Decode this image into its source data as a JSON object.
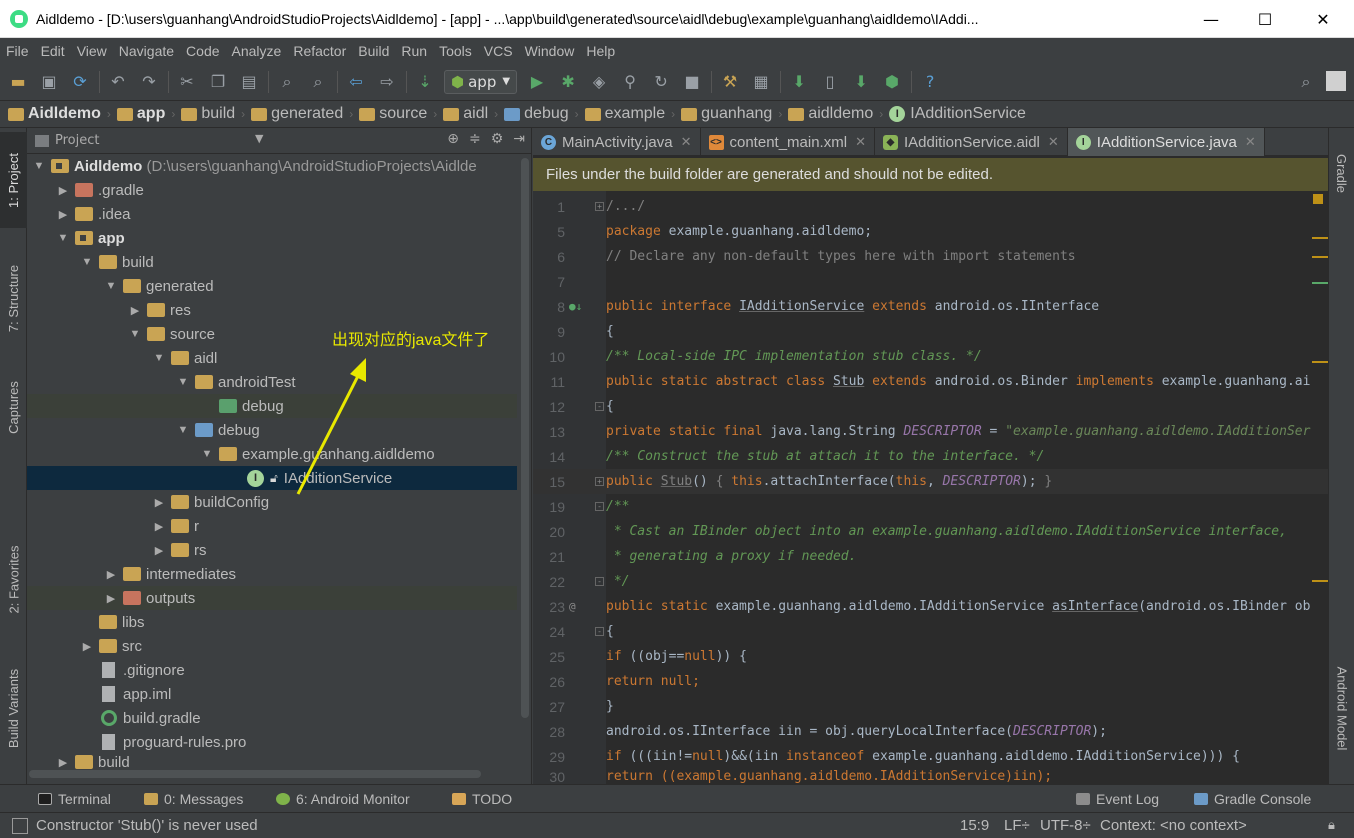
{
  "window": {
    "title": "Aidldemo - [D:\\users\\guanhang\\AndroidStudioProjects\\Aidldemo] - [app] - ...\\app\\build\\generated\\source\\aidl\\debug\\example\\guanhang\\aidldemo\\IAddi...",
    "minimize": "—",
    "maximize": "☐",
    "close": "✕"
  },
  "menu": [
    "File",
    "Edit",
    "View",
    "Navigate",
    "Code",
    "Analyze",
    "Refactor",
    "Build",
    "Run",
    "Tools",
    "VCS",
    "Window",
    "Help"
  ],
  "toolbar": {
    "run_config": "app",
    "help": "?"
  },
  "breadcrumb": [
    "Aidldemo",
    "app",
    "build",
    "generated",
    "source",
    "aidl",
    "debug",
    "example",
    "guanhang",
    "aidldemo",
    "IAdditionService"
  ],
  "left_tabs": [
    "1: Project",
    "7: Structure",
    "Captures",
    "2: Favorites",
    "Build Variants"
  ],
  "right_tabs": [
    "Gradle",
    "Android Model"
  ],
  "project_panel": {
    "view_mode": "Project",
    "tree": [
      {
        "name": "Aidldemo",
        "extra": "(D:\\users\\guanhang\\AndroidStudioProjects\\Aidlde"
      },
      {
        "name": ".gradle"
      },
      {
        "name": ".idea"
      },
      {
        "name": "app"
      },
      {
        "name": "build"
      },
      {
        "name": "generated"
      },
      {
        "name": "res"
      },
      {
        "name": "source"
      },
      {
        "name": "aidl"
      },
      {
        "name": "androidTest"
      },
      {
        "name": "debug"
      },
      {
        "name": "debug"
      },
      {
        "name": "example.guanhang.aidldemo"
      },
      {
        "name": "IAdditionService"
      },
      {
        "name": "buildConfig"
      },
      {
        "name": "r"
      },
      {
        "name": "rs"
      },
      {
        "name": "intermediates"
      },
      {
        "name": "outputs"
      },
      {
        "name": "libs"
      },
      {
        "name": "src"
      },
      {
        "name": ".gitignore"
      },
      {
        "name": "app.iml"
      },
      {
        "name": "build.gradle"
      },
      {
        "name": "proguard-rules.pro"
      },
      {
        "name": "build"
      }
    ]
  },
  "annotation": "出现对应的java文件了",
  "editor": {
    "tabs": [
      {
        "label": "MainActivity.java"
      },
      {
        "label": "content_main.xml"
      },
      {
        "label": "IAdditionService.aidl"
      },
      {
        "label": "IAdditionService.java"
      }
    ],
    "banner": "Files under the build folder are generated and should not be edited.",
    "line_numbers": [
      "1",
      "5",
      "6",
      "7",
      "8",
      "9",
      "10",
      "11",
      "12",
      "13",
      "14",
      "15",
      "19",
      "20",
      "21",
      "22",
      "23",
      "24",
      "25",
      "26",
      "27",
      "28",
      "29",
      "30"
    ],
    "code": {
      "l1": "/.../",
      "l5a": "package",
      "l5b": " example.guanhang.aidldemo;",
      "l6": "// Declare any non-default types here with import statements",
      "l8a": "public interface ",
      "l8b": "IAdditionService",
      "l8c": " extends ",
      "l8d": "android.os.IInterface",
      "l9": "{",
      "l10": "/** Local-side IPC implementation stub class. */",
      "l11a": "public static abstract class ",
      "l11b": "Stub",
      "l11c": " extends ",
      "l11d": "android.os.Binder ",
      "l11e": "implements ",
      "l11f": "example.guanhang.ai",
      "l12": "{",
      "l13a": "private static final ",
      "l13b": "java.lang.String ",
      "l13c": "DESCRIPTOR",
      "l13d": " = ",
      "l13e": "\"example.guanhang.aidldemo.IAdditionSer",
      "l14": "/** Construct the stub at attach it to the interface. */",
      "l15a": "public ",
      "l15b": "Stub",
      "l15c": "() ",
      "l15d": "{ ",
      "l15e": "this",
      "l15f": ".attachInterface(",
      "l15g": "this",
      "l15h": ", ",
      "l15i": "DESCRIPTOR",
      "l15j": "); ",
      "l15k": "}",
      "l19": "/**",
      "l20": " * Cast an IBinder object into an example.guanhang.aidldemo.IAdditionService interface,",
      "l21": " * generating a proxy if needed.",
      "l22": " */",
      "l23a": "public static ",
      "l23b": "example.guanhang.aidldemo.IAdditionService ",
      "l23c": "asInterface",
      "l23d": "(android.os.IBinder ob",
      "l24": "{",
      "l25a": "if ",
      "l25b": "((obj==",
      "l25c": "null",
      "l25d": ")) {",
      "l26a": "return ",
      "l26b": "null",
      "l26c": ";",
      "l27": "}",
      "l28a": "android.os.IInterface iin = obj.queryLocalInterface(",
      "l28b": "DESCRIPTOR",
      "l28c": ");",
      "l29a": "if ",
      "l29b": "(((iin!=",
      "l29c": "null",
      "l29d": ")&&(iin ",
      "l29e": "instanceof ",
      "l29f": "example.guanhang.aidldemo.IAdditionService))) {",
      "l30": "return ((example.guanhang.aidldemo.IAdditionService)iin);"
    }
  },
  "bottom_tabs": {
    "terminal": "Terminal",
    "messages": "0: Messages",
    "android_monitor": "6: Android Monitor",
    "todo": "TODO",
    "event_log": "Event Log",
    "gradle_console": "Gradle Console"
  },
  "status": {
    "message": "Constructor 'Stub()' is never used",
    "position": "15:9",
    "line_sep": "LF÷",
    "encoding": "UTF-8÷",
    "context": "Context: <no context>"
  },
  "colors": {
    "background": "#3c3f41",
    "editor_bg": "#2b2b2b",
    "keyword": "#cc7832",
    "banner": "#56542f",
    "annotation": "#e8e800"
  }
}
